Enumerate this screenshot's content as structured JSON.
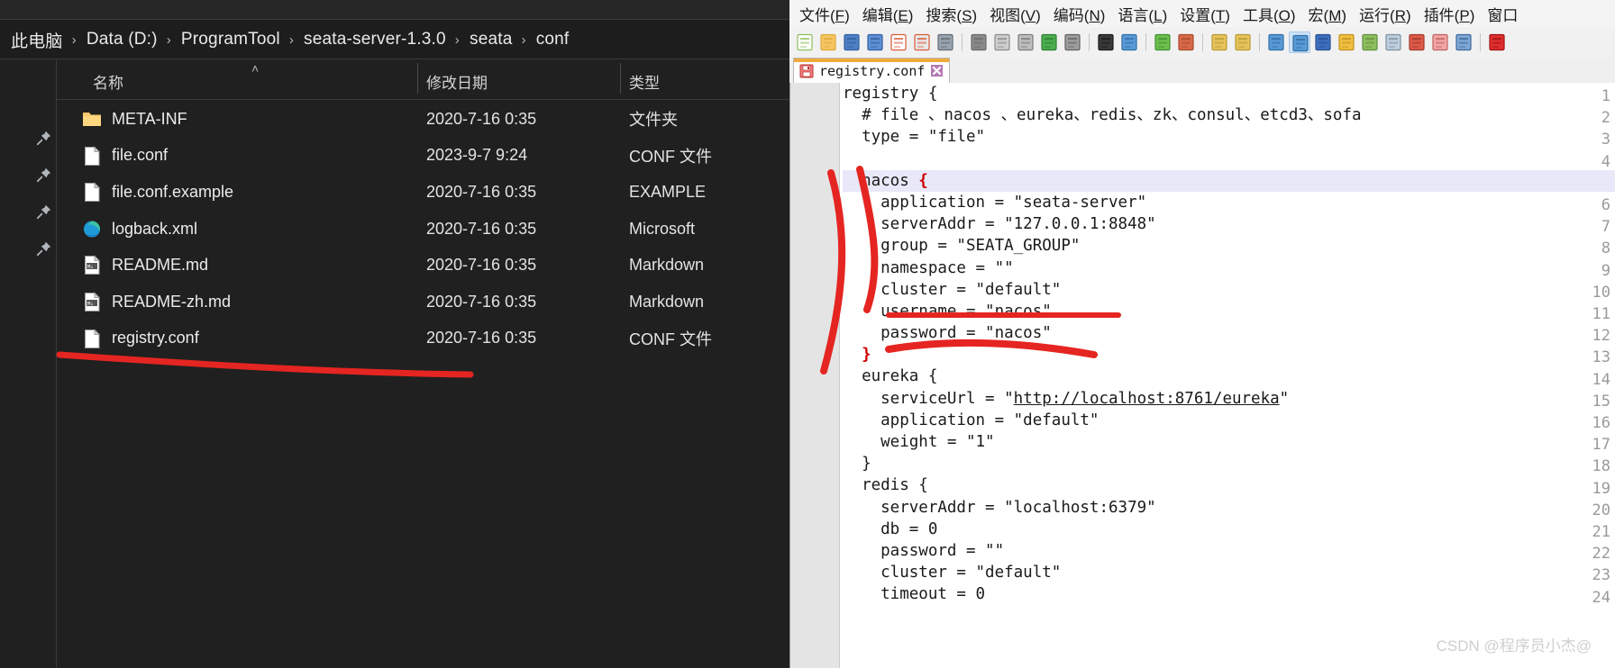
{
  "explorer": {
    "breadcrumb": {
      "separator": "›",
      "items": [
        "此电脑",
        "Data (D:)",
        "ProgramTool",
        "seata-server-1.3.0",
        "seata",
        "conf"
      ]
    },
    "columns": {
      "name": "名称",
      "date": "修改日期",
      "type": "类型",
      "sort_indicator": "˄"
    },
    "rows": [
      {
        "icon": "folder-icon",
        "name": "META-INF",
        "date": "2020-7-16 0:35",
        "type": "文件夹"
      },
      {
        "icon": "file-icon",
        "name": "file.conf",
        "date": "2023-9-7 9:24",
        "type": "CONF 文件"
      },
      {
        "icon": "file-icon",
        "name": "file.conf.example",
        "date": "2020-7-16 0:35",
        "type": "EXAMPLE"
      },
      {
        "icon": "edge-browser-icon",
        "name": "logback.xml",
        "date": "2020-7-16 0:35",
        "type": "Microsoft"
      },
      {
        "icon": "markdown-file-icon",
        "name": "README.md",
        "date": "2020-7-16 0:35",
        "type": "Markdown"
      },
      {
        "icon": "markdown-file-icon",
        "name": "README-zh.md",
        "date": "2020-7-16 0:35",
        "type": "Markdown"
      },
      {
        "icon": "file-icon",
        "name": "registry.conf",
        "date": "2020-7-16 0:35",
        "type": "CONF 文件"
      }
    ],
    "pins": [
      "pin-icon",
      "pin-icon",
      "pin-icon",
      "pin-icon"
    ],
    "annotation": "red-underline-registry-conf"
  },
  "notepad": {
    "menu": [
      {
        "label": "文件(F)",
        "mnemonic": "F"
      },
      {
        "label": "编辑(E)",
        "mnemonic": "E"
      },
      {
        "label": "搜索(S)",
        "mnemonic": "S"
      },
      {
        "label": "视图(V)",
        "mnemonic": "V"
      },
      {
        "label": "编码(N)",
        "mnemonic": "N"
      },
      {
        "label": "语言(L)",
        "mnemonic": "L"
      },
      {
        "label": "设置(T)",
        "mnemonic": "T"
      },
      {
        "label": "工具(O)",
        "mnemonic": "O"
      },
      {
        "label": "宏(M)",
        "mnemonic": "M"
      },
      {
        "label": "运行(R)",
        "mnemonic": "R"
      },
      {
        "label": "插件(P)",
        "mnemonic": "P"
      },
      {
        "label": "窗口",
        "mnemonic": ""
      }
    ],
    "toolbar_icons": [
      "new-file-icon",
      "open-file-icon",
      "save-icon",
      "save-all-icon",
      "close-file-icon",
      "close-all-icon",
      "print-icon",
      "sep",
      "cut-icon",
      "copy-icon",
      "paste-icon",
      "undo-icon",
      "redo-icon",
      "sep",
      "find-icon",
      "replace-icon",
      "sep",
      "zoom-in-icon",
      "zoom-out-icon",
      "sep",
      "sync-vertical-icon",
      "sync-horizontal-icon",
      "sep",
      "word-wrap-icon",
      "show-all-chars-icon",
      "indent-guide-icon",
      "user-defined-language-icon",
      "document-map-icon",
      "document-list-icon",
      "function-list-icon",
      "folder-as-workspace-icon",
      "monitor-icon",
      "sep",
      "record-macro-icon"
    ],
    "active_toolbar_index": 24,
    "tab": {
      "label": "registry.conf",
      "icon": "save-floppy-icon",
      "close_icon": "close-icon"
    },
    "editor": {
      "current_line": 5,
      "first_line_number": 1,
      "lines": [
        "registry {",
        "  # file 、nacos 、eureka、redis、zk、consul、etcd3、sofa",
        "  type = \"file\"",
        "",
        "  nacos {",
        "    application = \"seata-server\"",
        "    serverAddr = \"127.0.0.1:8848\"",
        "    group = \"SEATA_GROUP\"",
        "    namespace = \"\"",
        "    cluster = \"default\"",
        "    username = \"nacos\"",
        "    password = \"nacos\"",
        "  }",
        "  eureka {",
        "    serviceUrl = \"http://localhost:8761/eureka\"",
        "    application = \"default\"",
        "    weight = \"1\"",
        "  }",
        "  redis {",
        "    serverAddr = \"localhost:6379\"",
        "    db = 0",
        "    password = \"\"",
        "    cluster = \"default\"",
        "    timeout = 0"
      ],
      "annotations": [
        "red-curve-left-of-nacos-block",
        "red-underline-username-nacos",
        "red-stroke-after-closing-brace-line13"
      ]
    }
  },
  "watermark": "CSDN @程序员小杰@",
  "colors": {
    "explorer_bg": "#202020",
    "explorer_text": "#ececec",
    "npp_chrome": "#f1f1f1",
    "editor_bg": "#ffffff",
    "gutter_bg": "#e4e4e4",
    "current_line_bg": "#e8e8f8",
    "brace_red": "#cc0000",
    "tab_active_bar": "#efab3b",
    "annotation_red": "#e52521"
  }
}
